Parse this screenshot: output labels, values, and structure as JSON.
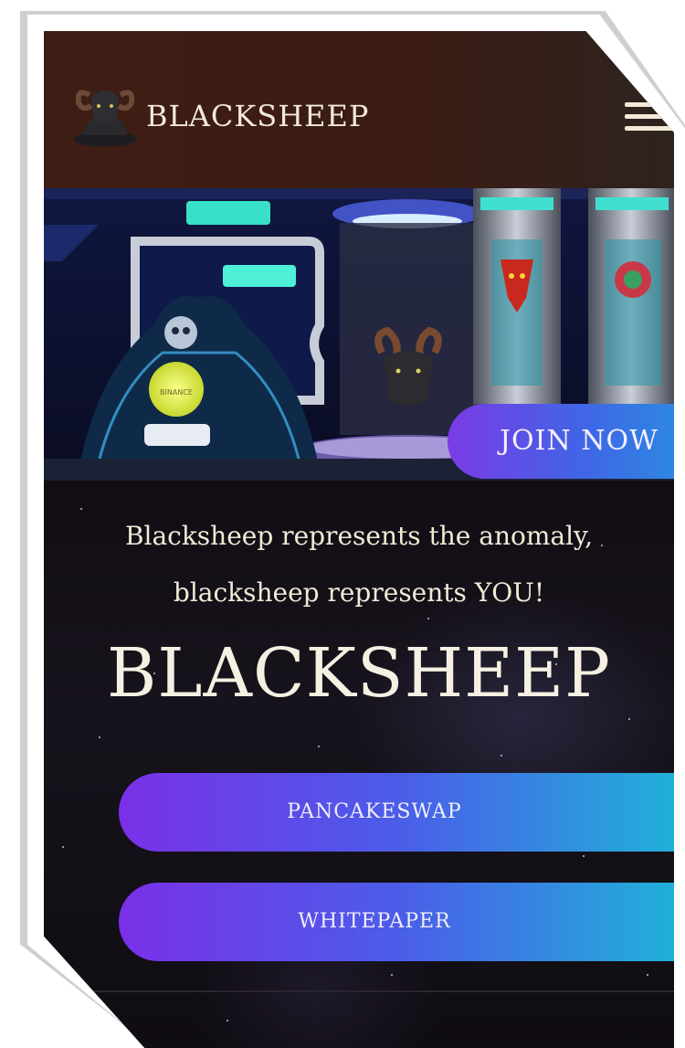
{
  "header": {
    "brand": "BLACKSHEEP",
    "logo_icon": "ram-head-logo-icon",
    "menu_icon": "hamburger-menu-icon",
    "background_color": "#3e1d14"
  },
  "hero": {
    "join_label": "JOIN NOW",
    "orb_label": "BINANCE"
  },
  "content": {
    "tagline_line1": "Blacksheep represents the anomaly,",
    "tagline_line2": "blacksheep represents YOU!",
    "title": "BLACKSHEEP"
  },
  "buttons": {
    "pancakeswap_label": "PANCAKESWAP",
    "whitepaper_label": "WHITEPAPER"
  },
  "colors": {
    "accent_purple": "#7a30e8",
    "accent_cyan": "#1fb3d8",
    "text_cream": "#f0ead6"
  }
}
